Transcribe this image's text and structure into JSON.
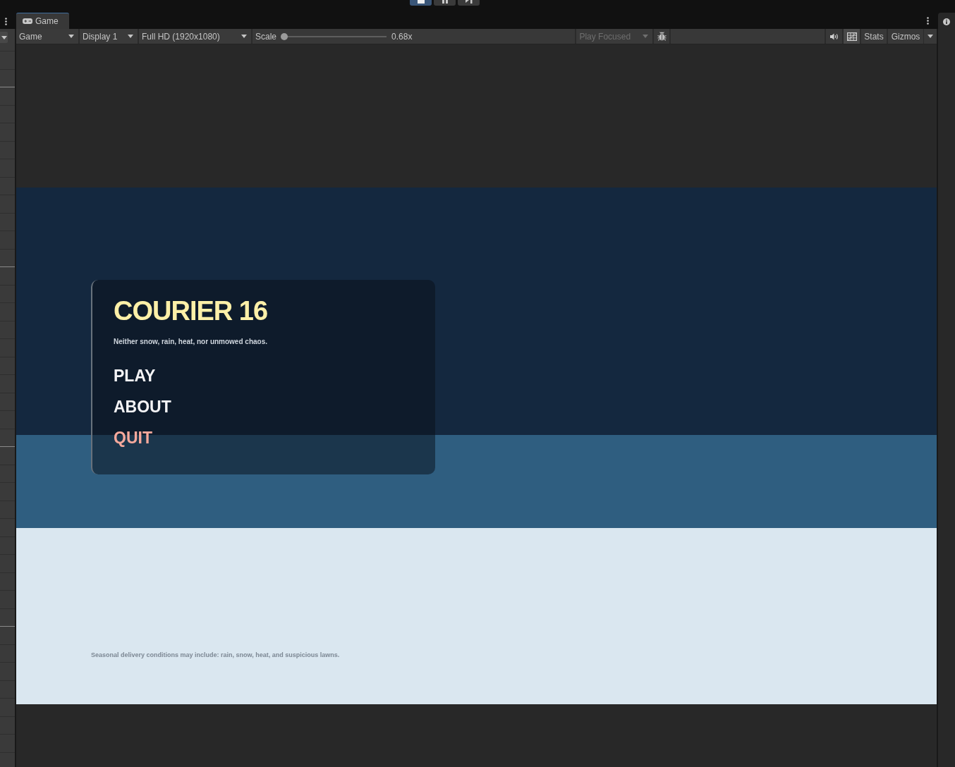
{
  "editor_toolbar": {
    "play_controls": [
      {
        "kind": "play",
        "selected": true
      },
      {
        "kind": "pause",
        "selected": false
      },
      {
        "kind": "step",
        "selected": false
      }
    ]
  },
  "tabs": [
    {
      "label": "Game",
      "selected": true
    }
  ],
  "game_toolbar": {
    "dropdowns": [
      {
        "value": "Game"
      },
      {
        "value": "Display 1"
      },
      {
        "value": "Full HD (1920x1080)"
      }
    ],
    "scale": {
      "label": "Scale",
      "level": 0,
      "reading": "0.68x"
    },
    "play_mode": {
      "value": "Play Focused",
      "disabled": true
    },
    "grid_toggle": {
      "on": true
    },
    "stats": {
      "label": "Stats"
    },
    "gizmos": {
      "label": "Gizmos"
    }
  },
  "game_view": {
    "menu": {
      "title": "COURIER 16",
      "tagline": "Neither snow, rain, heat, nor unmowed chaos.",
      "items": [
        {
          "label": "PLAY",
          "color": "#f4f4f6"
        },
        {
          "label": "ABOUT",
          "color": "#f4f4f6"
        },
        {
          "label": "QUIT",
          "color": "#f6a99c"
        }
      ]
    },
    "footer_note": "Seasonal delivery conditions may include: rain, snow, heat, and suspicious lawns."
  }
}
